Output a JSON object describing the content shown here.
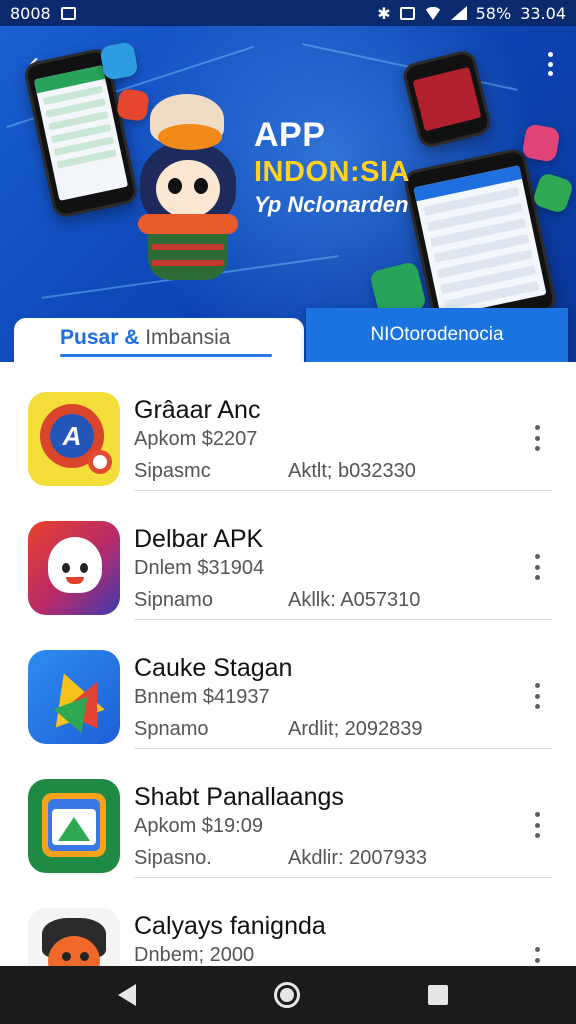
{
  "status_bar": {
    "left_text": "8008",
    "battery": "58%",
    "time": "33.04"
  },
  "hero": {
    "title": "APP",
    "subtitle": "INDON:SIA",
    "tagline": "Yp Nclonarden"
  },
  "tabs": [
    {
      "label_accent": "Pusar &",
      "label_rest": " Imbansia",
      "active": true
    },
    {
      "label": "NIOtorodenocia",
      "active": false
    }
  ],
  "apps": [
    {
      "name": "Grâaar Anc",
      "meta": "Apkom $2207",
      "status": "Sipasmc",
      "code": "Aktlt; b032330",
      "icon": "app-icon-red-badge"
    },
    {
      "name": "Delbar APK",
      "meta": "Dnlem $31904",
      "status": "Sipnamo",
      "code": "Akllk: A057310",
      "icon": "app-icon-ghost-mascot"
    },
    {
      "name": "Cauke Stagan",
      "meta": "Bnnem $41937",
      "status": "Spnamo",
      "code": "Ardlit; 2092839",
      "icon": "app-icon-triangle-logo"
    },
    {
      "name": "Shabt Panallaangs",
      "meta": "Apkom $19:09",
      "status": "Sipasno.",
      "code": "Akdlir: 2007933",
      "icon": "app-icon-photo-gallery"
    },
    {
      "name": "Calyays fanignda",
      "meta": "Dnbem; 2000",
      "status": "",
      "code": "",
      "icon": "app-icon-orange-character"
    }
  ],
  "colors": {
    "accent": "#1b73e0",
    "hero_bg": "#0d47b8",
    "hero_highlight": "#ffd21f"
  }
}
